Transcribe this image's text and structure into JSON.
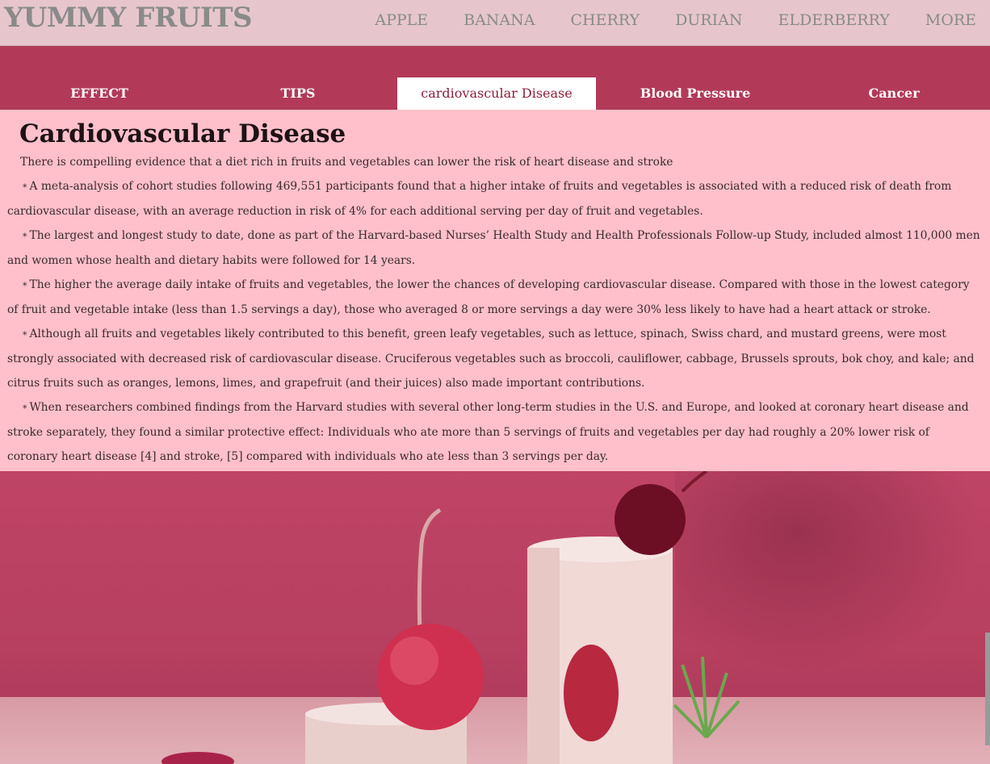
{
  "brand": "YUMMY FRUITS",
  "nav": [
    "APPLE",
    "BANANA",
    "CHERRY",
    "DURIAN",
    "ELDERBERRY",
    "MORE"
  ],
  "tabs": [
    {
      "label": "EFFECT",
      "active": false
    },
    {
      "label": "TIPS",
      "active": false
    },
    {
      "label": "cardiovascular Disease",
      "active": true
    },
    {
      "label": "Blood Pressure",
      "active": false
    },
    {
      "label": "Cancer",
      "active": false
    }
  ],
  "section": {
    "title": "Cardiovascular Disease",
    "lead": "There is compelling evidence that a diet rich in fruits and vegetables can lower the risk of heart disease and stroke",
    "bullet_marker": "*",
    "bullets": [
      "A meta-analysis of cohort studies following 469,551 participants found that a higher intake of fruits and vegetables is associated with a reduced risk of death from cardiovascular disease, with an average reduction in risk of 4% for each additional serving per day of fruit and vegetables.",
      "The largest and longest study to date, done as part of the Harvard-based Nurses’ Health Study and Health Professionals Follow-up Study, included almost 110,000 men and women whose health and dietary habits were followed for 14 years.",
      "The higher the average daily intake of fruits and vegetables, the lower the chances of developing cardiovascular disease. Compared with those in the lowest category of fruit and vegetable intake (less than 1.5 servings a day), those who averaged 8 or more servings a day were 30% less likely to have had a heart attack or stroke.",
      "Although all fruits and vegetables likely contributed to this benefit, green leafy vegetables, such as lettuce, spinach, Swiss chard, and mustard greens, were most strongly associated with decreased risk of cardiovascular disease. Cruciferous vegetables such as broccoli, cauliflower, cabbage, Brussels sprouts, bok choy, and kale; and citrus fruits such as oranges, lemons, limes, and grapefruit (and their juices) also made important contributions.",
      "When researchers combined findings from the Harvard studies with several other long-term studies in the U.S. and Europe, and looked at coronary heart disease and stroke separately, they found a similar protective effect: Individuals who ate more than 5 servings of fruits and vegetables per day had roughly a 20% lower risk of coronary heart disease [4] and stroke, [5] compared with individuals who ate less than 3 servings per day."
    ]
  },
  "colors": {
    "topbar": "#e6c6cc",
    "band": "#b23a58",
    "content": "#ffc0cb",
    "tab_active_text": "#8b1f3a"
  }
}
